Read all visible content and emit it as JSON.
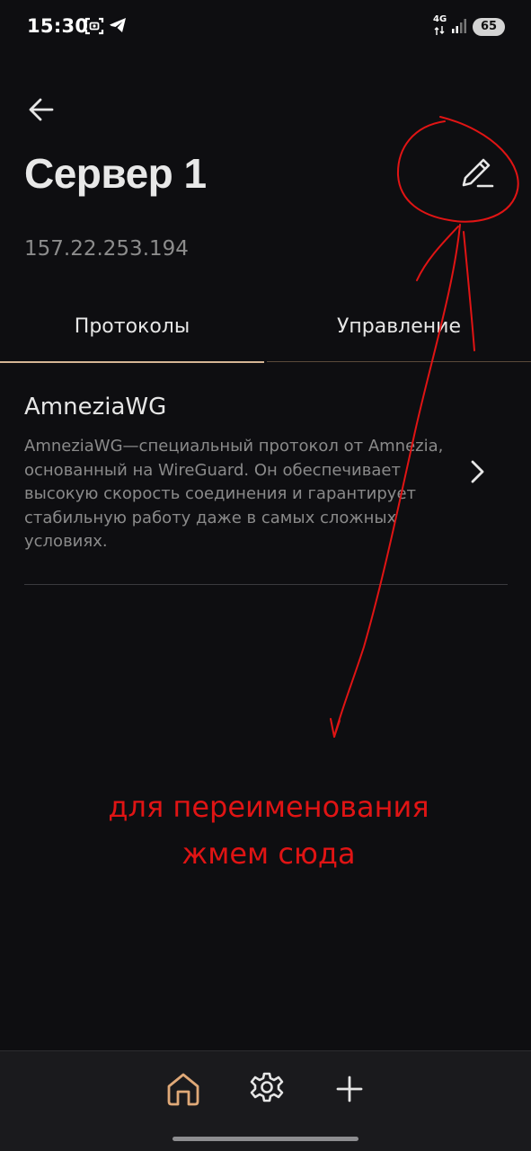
{
  "status_bar": {
    "time": "15:30",
    "network_type": "4G",
    "battery_level": "65"
  },
  "header": {
    "back_icon": "arrow-left-icon",
    "title": "Сервер 1",
    "edit_icon": "pencil-icon",
    "ip_address": "157.22.253.194"
  },
  "tabs": [
    {
      "label": "Протоколы",
      "active": true
    },
    {
      "label": "Управление",
      "active": false
    }
  ],
  "protocols": [
    {
      "title": "AmneziaWG",
      "description": "AmneziaWG—специальный протокол от Amnezia, основанный на WireGuard. Он обеспечивает высокую скорость соединения и гарантирует стабильную работу даже в самых сложных условиях.",
      "icon": "chevron-right-icon"
    }
  ],
  "annotation": {
    "line1": "для переименования",
    "line2": "жмем сюда",
    "color": "#e01414"
  },
  "bottom_nav": [
    {
      "icon": "home-icon",
      "active": true
    },
    {
      "icon": "gear-icon",
      "active": false
    },
    {
      "icon": "plus-icon",
      "active": false
    }
  ],
  "colors": {
    "background": "#0e0e11",
    "accent": "#d5b595",
    "nav_active": "#e0a978"
  }
}
